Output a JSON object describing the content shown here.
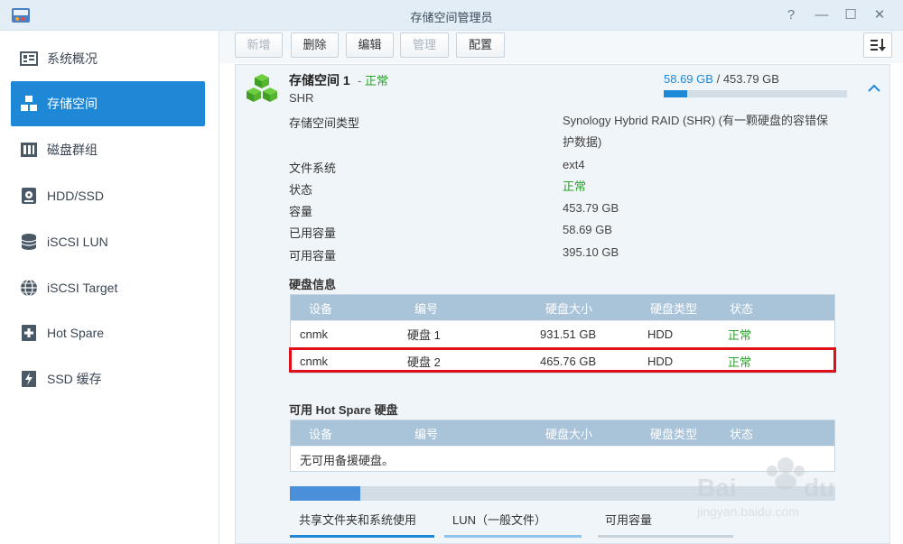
{
  "window": {
    "title": "存储空间管理员",
    "controls": {
      "help": "?",
      "minimize": "—",
      "maximize": "☐",
      "close": "✕"
    }
  },
  "sidebar": {
    "items": [
      {
        "label": "系统概况",
        "icon": "overview-icon",
        "active": false
      },
      {
        "label": "存储空间",
        "icon": "storage-cubes-icon",
        "active": true
      },
      {
        "label": "磁盘群组",
        "icon": "disk-group-icon",
        "active": false
      },
      {
        "label": "HDD/SSD",
        "icon": "hdd-icon",
        "active": false
      },
      {
        "label": "iSCSI LUN",
        "icon": "database-icon",
        "active": false
      },
      {
        "label": "iSCSI Target",
        "icon": "globe-icon",
        "active": false
      },
      {
        "label": "Hot Spare",
        "icon": "plus-box-icon",
        "active": false
      },
      {
        "label": "SSD 缓存",
        "icon": "flash-icon",
        "active": false
      }
    ]
  },
  "toolbar": {
    "buttons": [
      {
        "label": "新增",
        "enabled": false
      },
      {
        "label": "删除",
        "enabled": true
      },
      {
        "label": "编辑",
        "enabled": true
      },
      {
        "label": "管理",
        "enabled": false
      },
      {
        "label": "配置",
        "enabled": true
      }
    ]
  },
  "volume": {
    "name": "存储空间 1",
    "separator": "-",
    "status": "正常",
    "raid_short": "SHR",
    "usage_used": "58.69 GB",
    "usage_sep": "/",
    "usage_total": "453.79 GB",
    "usage_fraction": 0.129,
    "properties": [
      {
        "label": "存储空间类型",
        "value": "Synology Hybrid RAID (SHR) (有一颗硬盘的容错保护数据)",
        "ok": false
      },
      {
        "label": "文件系统",
        "value": "ext4",
        "ok": false
      },
      {
        "label": "状态",
        "value": "正常",
        "ok": true
      },
      {
        "label": "容量",
        "value": "453.79 GB",
        "ok": false
      },
      {
        "label": "已用容量",
        "value": "58.69 GB",
        "ok": false
      },
      {
        "label": "可用容量",
        "value": "395.10 GB",
        "ok": false
      }
    ]
  },
  "disk_info": {
    "title": "硬盘信息",
    "headers": [
      "设备",
      "编号",
      "硬盘大小",
      "硬盘类型",
      "状态"
    ],
    "rows": [
      [
        "cnmk",
        "硬盘 1",
        "931.51 GB",
        "HDD",
        "正常"
      ],
      [
        "cnmk",
        "硬盘 2",
        "465.76 GB",
        "HDD",
        "正常"
      ]
    ]
  },
  "hot_spare": {
    "title": "可用 Hot Spare 硬盘",
    "headers": [
      "设备",
      "编号",
      "硬盘大小",
      "硬盘类型",
      "状态"
    ],
    "empty_text": "无可用备援硬盘。"
  },
  "capacity_chart": {
    "fraction_used": 0.129,
    "legend": [
      "共享文件夹和系统使用",
      "LUN（一般文件）",
      "可用容量"
    ],
    "colors": [
      "#1e87d6",
      "#8fc3ea",
      "#c8d2db"
    ]
  },
  "colors": {
    "accent": "#1e87d6",
    "ok": "#2aa12a",
    "highlight": "#e0101a",
    "table_header": "#a9c3d9"
  }
}
